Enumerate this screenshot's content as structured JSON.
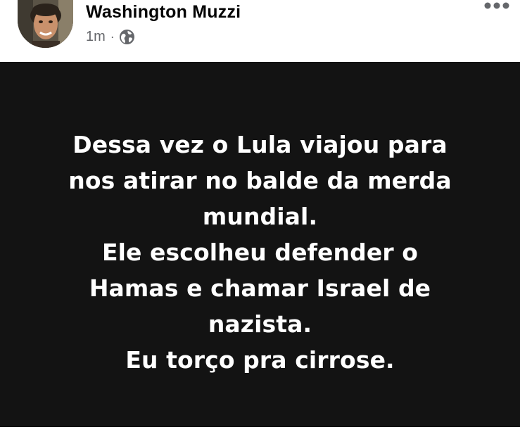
{
  "post": {
    "author": "Washington Muzzi",
    "timestamp": "1m",
    "separator": "·",
    "audience_icon": "globe-icon",
    "more_icon": "more-options-icon",
    "text_lines": [
      "Dessa vez o Lula viajou para",
      "nos atirar no balde da merda",
      "mundial.",
      "Ele escolheu defender o",
      "Hamas e chamar Israel de",
      "nazista.",
      "Eu torço pra cirrose."
    ],
    "card_background": "#131313",
    "text_color": "#ffffff",
    "meta_color": "#65676b"
  }
}
